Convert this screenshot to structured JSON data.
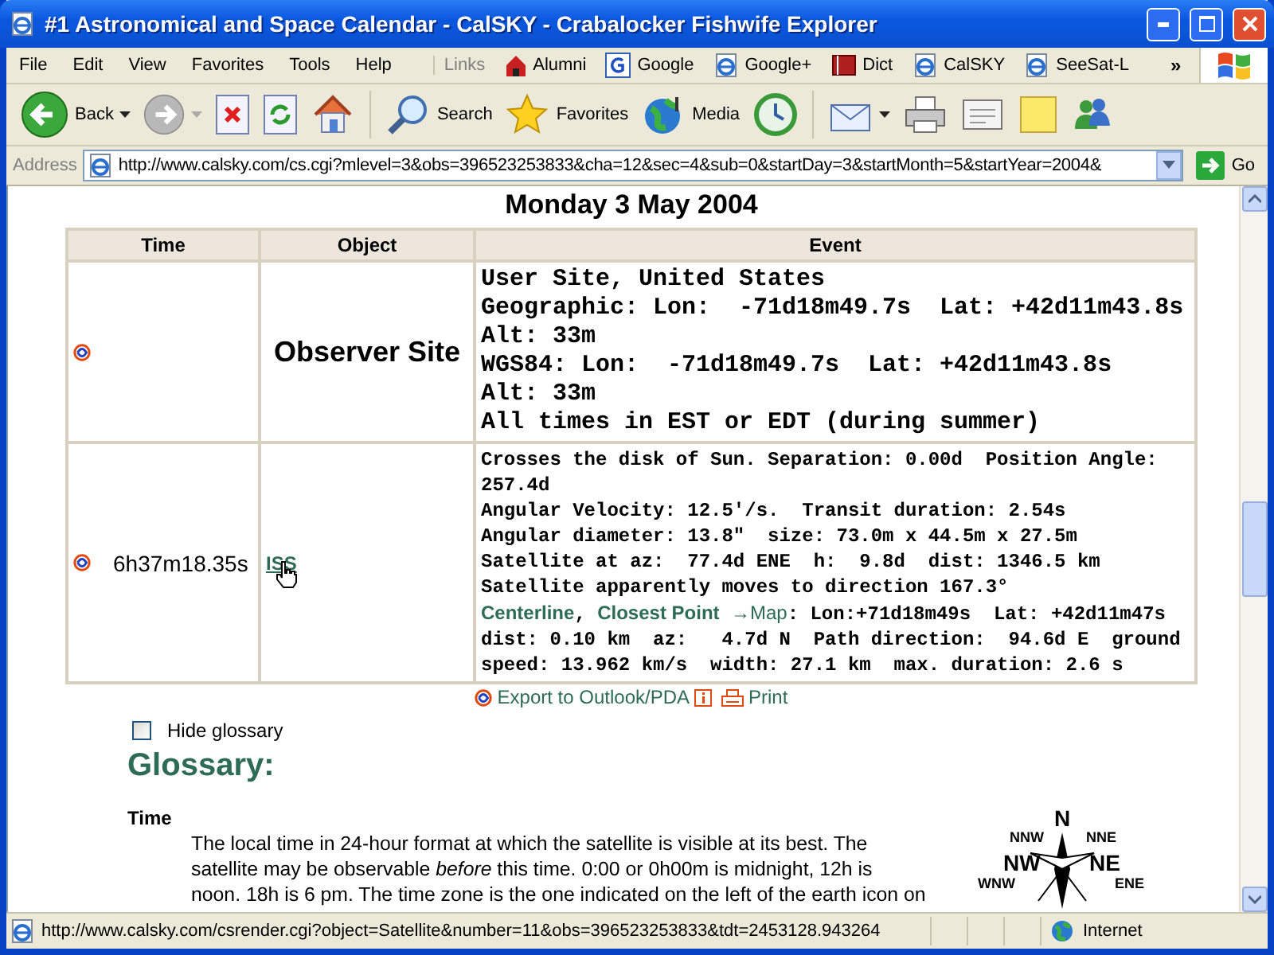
{
  "window": {
    "title": "#1 Astronomical and Space Calendar - CalSKY - Crabalocker Fishwife Explorer"
  },
  "menu": [
    "File",
    "Edit",
    "View",
    "Favorites",
    "Tools",
    "Help"
  ],
  "links_bar": {
    "label": "Links",
    "overflow": "»",
    "items": [
      {
        "kind": "school",
        "label": "Alumni"
      },
      {
        "kind": "google",
        "label": "Google"
      },
      {
        "kind": "page",
        "label": "Google+"
      },
      {
        "kind": "book",
        "label": "Dict"
      },
      {
        "kind": "page",
        "label": "CalSKY"
      },
      {
        "kind": "page",
        "label": "SeeSat-L"
      }
    ]
  },
  "toolbar": [
    {
      "kind": "back",
      "label": "Back"
    },
    {
      "kind": "forward"
    },
    {
      "kind": "stop"
    },
    {
      "kind": "refresh"
    },
    {
      "kind": "home"
    },
    {
      "kind": "search",
      "label": "Search"
    },
    {
      "kind": "favorites",
      "label": "Favorites"
    },
    {
      "kind": "media",
      "label": "Media"
    },
    {
      "kind": "history"
    },
    {
      "kind": "mail"
    },
    {
      "kind": "print"
    },
    {
      "kind": "edit"
    },
    {
      "kind": "notes"
    },
    {
      "kind": "messenger"
    }
  ],
  "address": {
    "label": "Address",
    "value": "http://www.calsky.com/cs.cgi?mlevel=3&obs=396523253833&cha=12&sec=4&sub=0&startDay=3&startMonth=5&startYear=2004&",
    "go": "Go"
  },
  "page": {
    "heading": "Monday 3 May 2004",
    "table": {
      "columns": [
        "Time",
        "Object",
        "Event"
      ],
      "rows": [
        {
          "kind": "site",
          "object": "Observer Site",
          "event": [
            {
              "kind": "text",
              "text": "User Site, United States"
            },
            {
              "kind": "text",
              "text": "Geographic: Lon:  -71d18m49.7s  Lat: +42d11m43.8s  Alt: 33m"
            },
            {
              "kind": "text",
              "text": "WGS84: Lon:  -71d18m49.7s  Lat: +42d11m43.8s  Alt: 33m"
            },
            {
              "kind": "text",
              "text": "All times in EST or EDT (during summer)"
            }
          ]
        },
        {
          "kind": "pass",
          "time": "6h37m18.35s",
          "object": "ISS",
          "event": [
            {
              "kind": "text",
              "text": "Crosses the disk of Sun. Separation: 0.00d  Position Angle: 257.4d"
            },
            {
              "kind": "text",
              "text": "Angular Velocity: 12.5'/s.  Transit duration: 2.54s"
            },
            {
              "kind": "text",
              "text": "Angular diameter: 13.8\"  size: 73.0m x 44.5m x 27.5m"
            },
            {
              "kind": "text",
              "text": "Satellite at az:  77.4d ENE  h:  9.8d  dist: 1346.5 km"
            },
            {
              "kind": "text",
              "text": "Satellite apparently moves to direction 167.3°"
            },
            {
              "kind": "links",
              "parts": [
                {
                  "kind": "link",
                  "text": "Centerline"
                },
                {
                  "kind": "plain",
                  "text": ", "
                },
                {
                  "kind": "link",
                  "text": "Closest Point"
                },
                {
                  "kind": "map",
                  "text": "→Map"
                },
                {
                  "kind": "plain",
                  "text": ": Lon:+71d18m49s  Lat: +42d11m47s  dist: 0.10 km  az:   4.7d N  Path direction:  94.6d E  ground speed: 13.962 km/s  width: 27.1 km  max. duration: 2.6 s"
                }
              ]
            }
          ]
        }
      ]
    },
    "export_link": "Export to Outlook/PDA",
    "print_link": "Print",
    "hide_glossary": {
      "label": "Hide glossary",
      "checked": false
    },
    "glossary": {
      "title": "Glossary:",
      "term": "Time",
      "definition": "The local time in 24-hour format at which the satellite is visible at its best. The satellite may be observable *before* this time. 0:00 or 0h00m is midnight, 12h is noon. 18h is 6 pm. The time zone is the one indicated on the left of the earth icon on"
    },
    "compass_labels": [
      "N",
      "NNW",
      "NNE",
      "NW",
      "NE",
      "WNW",
      "ENE"
    ]
  },
  "status_bar": {
    "url": "http://www.calsky.com/csrender.cgi?object=Satellite&number=11&obs=396523253833&tdt=2453128.943264",
    "zone": "Internet"
  }
}
